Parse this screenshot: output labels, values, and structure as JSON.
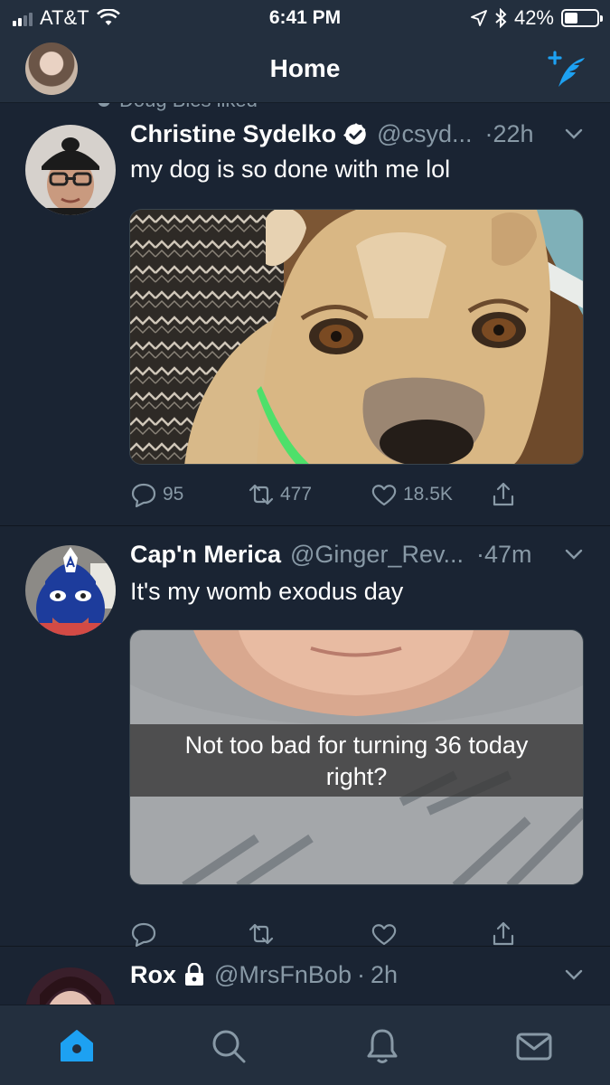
{
  "status_bar": {
    "carrier": "AT&T",
    "time": "6:41 PM",
    "battery": "42%",
    "battery_level": 0.42
  },
  "nav": {
    "title": "Home"
  },
  "feed": {
    "social_context": "Doug Bies liked",
    "tweets": [
      {
        "name": "Christine Sydelko",
        "verified": true,
        "handle": "@csyd...",
        "time": "22h",
        "text": "my dog is so done with me lol",
        "actions": {
          "replies": "95",
          "retweets": "477",
          "likes": "18.5K"
        }
      },
      {
        "name": "Cap'n Merica",
        "verified": false,
        "handle": "@Ginger_Rev...",
        "time": "47m",
        "text": "It's my womb exodus day",
        "media_caption": "Not too bad for turning 36 today right?",
        "actions": {
          "replies": "",
          "retweets": "",
          "likes": ""
        }
      },
      {
        "name": "Rox",
        "protected": true,
        "handle": "@MrsFnBob",
        "time": "2h"
      }
    ]
  },
  "tab_bar": {
    "active": "home",
    "tabs": [
      "home-icon",
      "search-icon",
      "notifications-icon",
      "messages-icon"
    ]
  },
  "colors": {
    "background": "#1a2433",
    "bar": "#232f3e",
    "accent": "#1da1f2",
    "secondary_text": "#8899a6"
  }
}
